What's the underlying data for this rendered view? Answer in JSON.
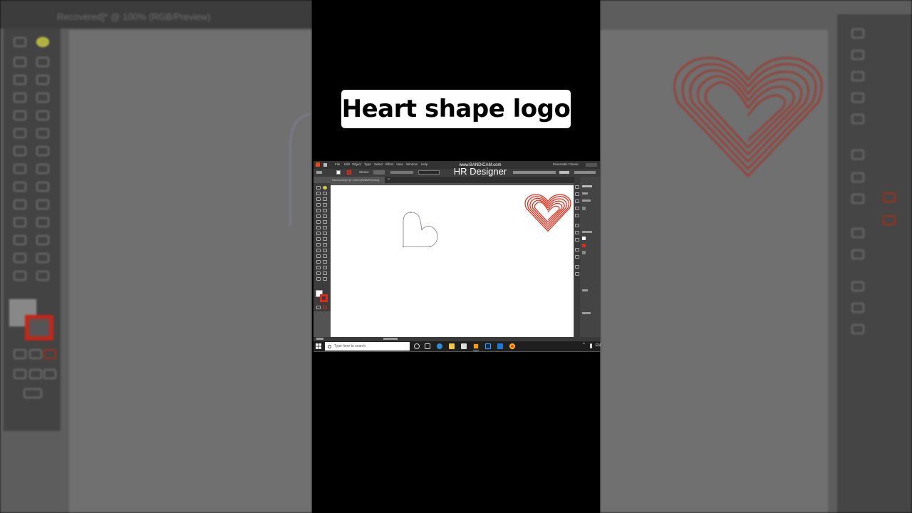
{
  "title_card": {
    "text": "Heart shape logo"
  },
  "backdrop": {
    "left_tab": "Recovered]* @ 100% (RGB/Preview)"
  },
  "watermark": {
    "line1": "www.BANDICAM.com",
    "line2": "HR Designer"
  },
  "illustrator": {
    "menu": [
      "File",
      "Edit",
      "Object",
      "Type",
      "Select",
      "Effect",
      "View",
      "Window",
      "Help"
    ],
    "workspace": "Essentials Classic",
    "stroke_label": "Stroke:",
    "tab_label": "Recovered]* @ 100% (RGB/Preview)"
  },
  "taskbar": {
    "search_placeholder": "Type here to search",
    "tray_lang": "EN"
  },
  "colors": {
    "heart_red": "#e02a17",
    "backdrop_heart": "#9a3a2f",
    "outline_heart": "#7a7a8a"
  },
  "icons": [
    "windows-start-icon",
    "search-icon",
    "task-view-icon",
    "edge-icon",
    "file-explorer-icon",
    "store-icon",
    "illustrator-icon",
    "photoshop-icon",
    "mail-icon",
    "chrome-icon"
  ]
}
